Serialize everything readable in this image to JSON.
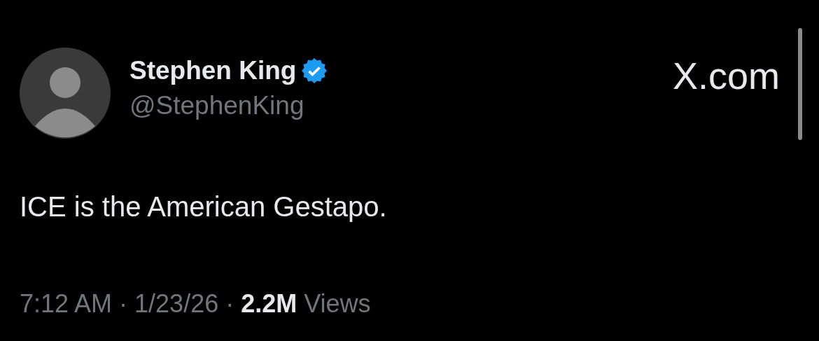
{
  "author": {
    "name": "Stephen King",
    "verified": true,
    "handle": "@StephenKing"
  },
  "brand": "X.com",
  "tweet": {
    "text": "ICE is the American Gestapo."
  },
  "meta": "7:12 AM · 1/23/26 · **2.2M** Views"
}
